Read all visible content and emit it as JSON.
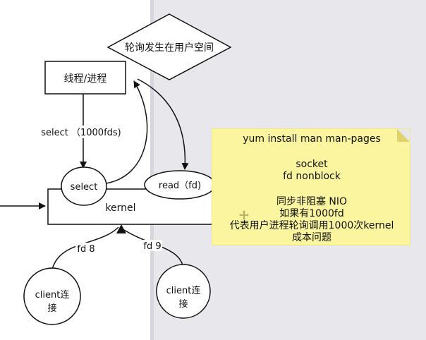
{
  "diamond": {
    "label": "轮询发生在用户空间"
  },
  "process_box": {
    "label": "线程/进程"
  },
  "edge_select": {
    "label": "select （1000fds)"
  },
  "select_node": {
    "label": "select"
  },
  "read_node": {
    "label": "read（fd)"
  },
  "kernel_box": {
    "label": "kernel"
  },
  "edges_fd": [
    {
      "label": "fd 8"
    },
    {
      "label": "fd 9"
    }
  ],
  "clients": [
    {
      "line1": "client连",
      "line2": "接"
    },
    {
      "line1": "client连",
      "line2": "接"
    }
  ],
  "note": {
    "lines": [
      "yum install man  man-pages",
      "",
      "socket",
      "fd nonblock",
      "",
      "同步非阻塞   NIO",
      "如果有1000fd",
      "代表用户进程轮询调用1000次kernel",
      "成本问题"
    ],
    "color": "#fbf5a0"
  },
  "icons": {
    "move": "move-arrows-icon"
  }
}
